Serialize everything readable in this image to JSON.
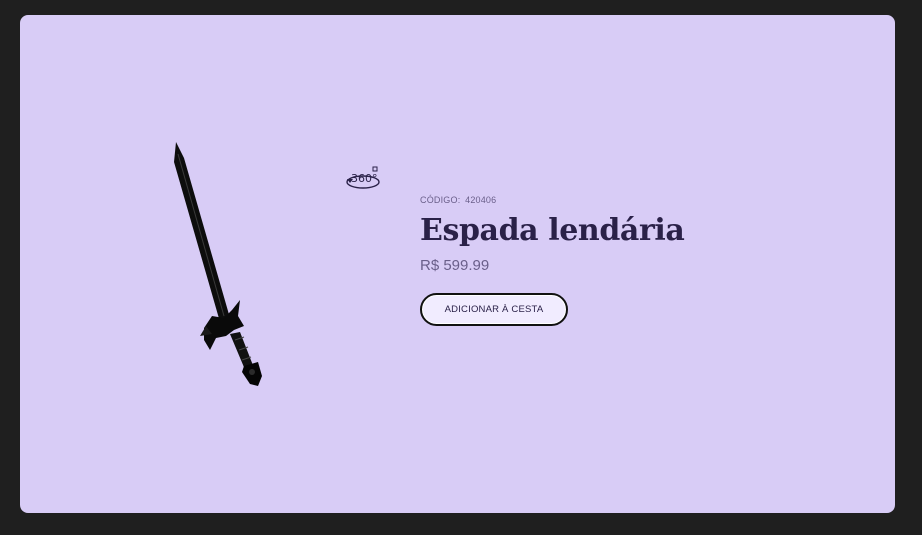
{
  "product": {
    "code_label": "CÓDIGO:",
    "code_value": "420406",
    "name": "Espada lendária",
    "price": "R$ 599.99",
    "add_to_cart_label": "ADICIONAR À CESTA",
    "view_360_label": "360°"
  },
  "icons": {
    "view_360": "rotate-360-icon",
    "product_image": "sword-image"
  },
  "colors": {
    "page_background": "#1f1f1f",
    "card_background": "#d8ccf6",
    "title": "#2a2148",
    "muted_text": "#6a5f8a"
  }
}
